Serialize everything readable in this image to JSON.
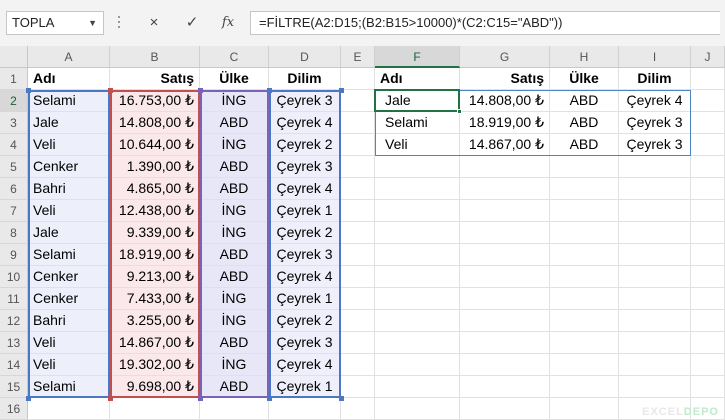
{
  "formula_bar": {
    "name_box": "TOPLA",
    "cancel_icon": "×",
    "enter_icon": "✓",
    "fx_label": "fx",
    "formula": "=FİLTRE(A2:D15;(B2:B15>10000)*(C2:C15=\"ABD\"))"
  },
  "columns": [
    "A",
    "B",
    "C",
    "D",
    "E",
    "F",
    "G",
    "H",
    "I",
    "J"
  ],
  "rows": [
    "1",
    "2",
    "3",
    "4",
    "5",
    "6",
    "7",
    "8",
    "9",
    "10",
    "11",
    "12",
    "13",
    "14",
    "15",
    "16"
  ],
  "source_table": {
    "headers": [
      "Adı",
      "Satış",
      "Ülke",
      "Dilim"
    ],
    "rows": [
      [
        "Selami",
        "16.753,00 ₺",
        "İNG",
        "Çeyrek 3"
      ],
      [
        "Jale",
        "14.808,00 ₺",
        "ABD",
        "Çeyrek 4"
      ],
      [
        "Veli",
        "10.644,00 ₺",
        "İNG",
        "Çeyrek 2"
      ],
      [
        "Cenker",
        "1.390,00 ₺",
        "ABD",
        "Çeyrek 3"
      ],
      [
        "Bahri",
        "4.865,00 ₺",
        "ABD",
        "Çeyrek 4"
      ],
      [
        "Veli",
        "12.438,00 ₺",
        "İNG",
        "Çeyrek 1"
      ],
      [
        "Jale",
        "9.339,00 ₺",
        "İNG",
        "Çeyrek 2"
      ],
      [
        "Selami",
        "18.919,00 ₺",
        "ABD",
        "Çeyrek 3"
      ],
      [
        "Cenker",
        "9.213,00 ₺",
        "ABD",
        "Çeyrek 4"
      ],
      [
        "Cenker",
        "7.433,00 ₺",
        "İNG",
        "Çeyrek 1"
      ],
      [
        "Bahri",
        "3.255,00 ₺",
        "İNG",
        "Çeyrek 2"
      ],
      [
        "Veli",
        "14.867,00 ₺",
        "ABD",
        "Çeyrek 3"
      ],
      [
        "Veli",
        "19.302,00 ₺",
        "İNG",
        "Çeyrek 4"
      ],
      [
        "Selami",
        "9.698,00 ₺",
        "ABD",
        "Çeyrek 1"
      ]
    ]
  },
  "result_table": {
    "headers": [
      "Adı",
      "Satış",
      "Ülke",
      "Dilim"
    ],
    "rows": [
      [
        "Jale",
        "14.808,00 ₺",
        "ABD",
        "Çeyrek 4"
      ],
      [
        "Selami",
        "18.919,00 ₺",
        "ABD",
        "Çeyrek 3"
      ],
      [
        "Veli",
        "14.867,00 ₺",
        "ABD",
        "Çeyrek 3"
      ]
    ]
  },
  "active_cell": "F2",
  "watermark": {
    "part1": "EXCEL",
    "part2": "DEPO"
  },
  "colors": {
    "selection": "#217346",
    "range_a": "#4a78c6",
    "range_b": "#c0504d",
    "range_c": "#7a62b8",
    "range_d": "#4a78c6",
    "spill": "#4b84c8"
  }
}
